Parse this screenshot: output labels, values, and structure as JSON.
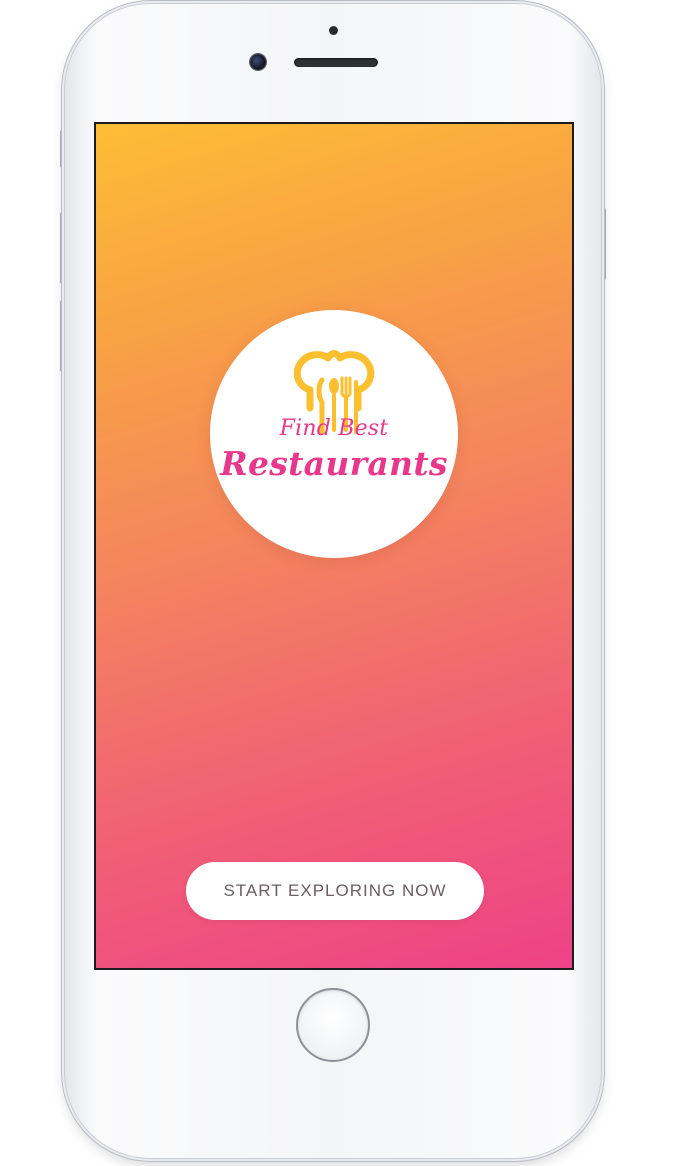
{
  "app": {
    "logo": {
      "line1": "Find Best",
      "line2": "Restaurants",
      "icon": "chef-hat-cutlery-icon"
    },
    "cta_label": "START EXPLORING NOW"
  },
  "colors": {
    "gradient_top": "#fdbd35",
    "gradient_bottom": "#ee4287",
    "logo_text": "#e8388c",
    "logo_icon": "#fcbf2f",
    "button_text": "#6b5d63"
  }
}
